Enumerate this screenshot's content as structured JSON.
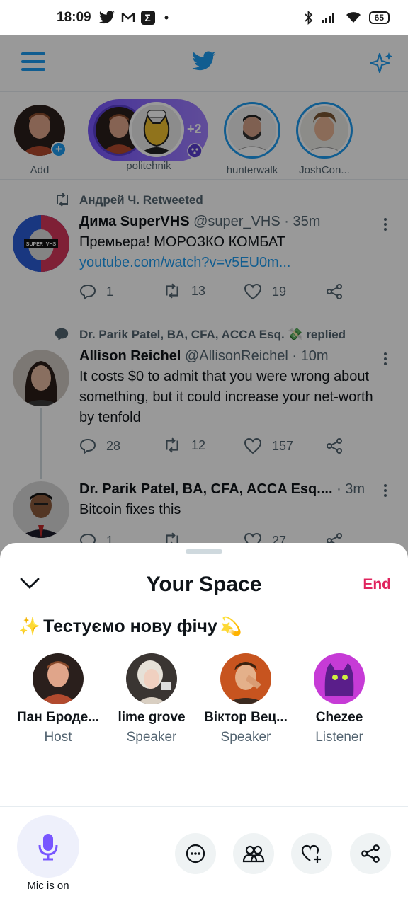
{
  "status_bar": {
    "time": "18:09",
    "icons": [
      "twitter-icon",
      "gmail-icon",
      "sigma-icon",
      "dot-icon"
    ],
    "right_icons": [
      "bluetooth-icon",
      "signal-icon",
      "wifi-icon"
    ],
    "battery": "65"
  },
  "header": {
    "menu_icon": "hamburger-icon",
    "logo_icon": "twitter-bird-icon",
    "sparkle_icon": "sparkle-icon"
  },
  "fleets": [
    {
      "label": "Add"
    },
    {
      "label": "politehnik",
      "extra_count": "+2"
    },
    {
      "label": "hunterwalk"
    },
    {
      "label": "JoshCon..."
    }
  ],
  "tweets": [
    {
      "context": "Андрей Ч. Retweeted",
      "name": "Дима SuperVHS",
      "handle": "@super_VHS · 35m",
      "text": "Премьера! МОРОЗКО КОМБАТ",
      "link": "youtube.com/watch?v=v5EU0m...",
      "avatar_text": "SUPER_VHS",
      "replies": "1",
      "retweets": "13",
      "likes": "19"
    },
    {
      "context": "Dr. Parik Patel, BA, CFA, ACCA Esq. 💸 replied",
      "name": "Allison Reichel",
      "handle": "@AllisonReichel · 10m",
      "text": "It costs $0 to admit that you were wrong about something, but it could increase your net-worth by tenfold",
      "replies": "28",
      "retweets": "12",
      "likes": "157"
    },
    {
      "name": "Dr. Parik Patel, BA, CFA, ACCA Esq....",
      "handle": "· 3m",
      "text": "Bitcoin fixes this",
      "replies": "1",
      "likes": "27"
    }
  ],
  "space": {
    "title": "Your Space",
    "end_label": "End",
    "topic": "Тестуємо нову фічу",
    "topic_lead_emoji": "✨",
    "topic_trail_emoji": "💫",
    "participants": [
      {
        "name": "Пан Броде...",
        "role": "Host"
      },
      {
        "name": "lime grove",
        "role": "Speaker"
      },
      {
        "name": "Віктор Вец...",
        "role": "Speaker"
      },
      {
        "name": "Chezee",
        "role": "Listener"
      }
    ],
    "mic_label": "Mic is on",
    "controls": [
      "more-icon",
      "people-icon",
      "heart-plus-icon",
      "share-icon"
    ]
  },
  "colors": {
    "accent": "#1d9bf0",
    "end": "#e0245e",
    "mic": "#7856ff",
    "space_pill": "#7856ff"
  }
}
